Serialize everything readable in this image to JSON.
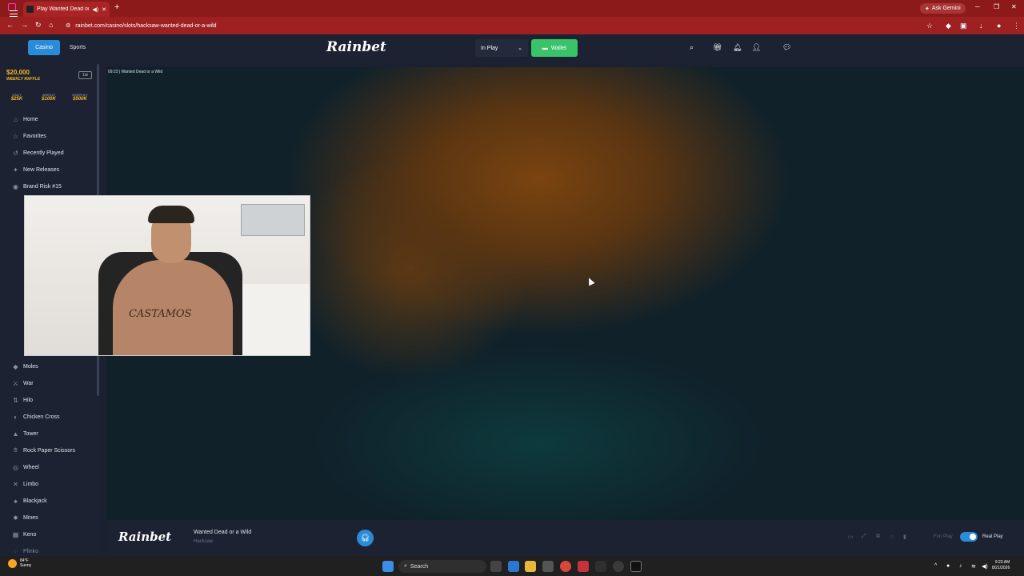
{
  "browser": {
    "tab_title": "Play Wanted Dead or a Wild",
    "new_tab": "+",
    "gemini_label": "Ask Gemini",
    "url": "rainbet.com/casino/slots/hacksaw-wanted-dead-or-a-wild"
  },
  "header": {
    "casino": "Casino",
    "sports": "Sports",
    "logo": "Rainbet",
    "in_play": "In Play",
    "wallet": "Wallet"
  },
  "raffle": {
    "amount": "$20,000",
    "label": "WEEKLY RAFFLE",
    "badge": "1st",
    "prizes": [
      {
        "label": "DAILY",
        "value": "$25K"
      },
      {
        "label": "WEEKLY",
        "value": "$100K"
      },
      {
        "label": "MONTHLY",
        "value": "$500K"
      }
    ]
  },
  "sidebar": {
    "top_items": [
      {
        "label": "Home",
        "icon": "home-icon"
      },
      {
        "label": "Favorites",
        "icon": "star-icon"
      },
      {
        "label": "Recently Played",
        "icon": "history-icon"
      },
      {
        "label": "New Releases",
        "icon": "sparkle-icon"
      },
      {
        "label": "Brand Risk #15",
        "icon": "globe-icon"
      }
    ],
    "games": [
      {
        "label": "Moles"
      },
      {
        "label": "War"
      },
      {
        "label": "Hilo"
      },
      {
        "label": "Chicken Cross"
      },
      {
        "label": "Tower"
      },
      {
        "label": "Rock Paper Scissors"
      },
      {
        "label": "Wheel"
      },
      {
        "label": "Limbo"
      },
      {
        "label": "Blackjack"
      },
      {
        "label": "Mines"
      },
      {
        "label": "Keno"
      },
      {
        "label": "Plinko"
      }
    ]
  },
  "game": {
    "time": "09:23",
    "title": "Wanted Dead or a Wild"
  },
  "footer": {
    "logo": "Rainbet",
    "game_name": "Wanted Dead or a Wild",
    "provider": "Hacksaw",
    "fun_play": "Fun Play",
    "real_play": "Real Play"
  },
  "taskbar": {
    "temp": "84°F",
    "condition": "Sunny",
    "search": "Search",
    "time": "9:23 AM",
    "date": "8/21/2026"
  },
  "webcam": {
    "tattoo_text": "CASTAMOS"
  }
}
